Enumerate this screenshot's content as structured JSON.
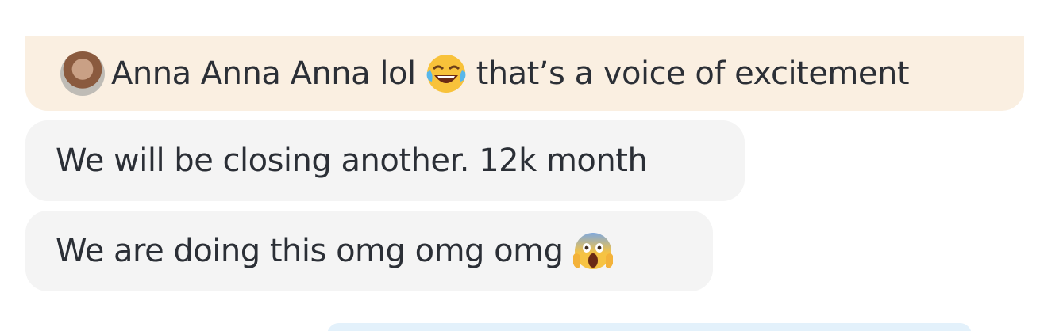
{
  "messages": [
    {
      "avatar_icon": "user-avatar",
      "text_before": "Anna Anna Anna lol",
      "emoji": "laughing-with-tears-emoji",
      "text_after": "that’s a voice of excitement",
      "background": "#faefe1"
    },
    {
      "text": "We will be closing another. 12k month",
      "background": "#f4f4f4"
    },
    {
      "text": "We are doing this omg omg omg",
      "emoji": "screaming-face-emoji",
      "background": "#f4f4f4"
    }
  ],
  "colors": {
    "text": "#2b2f36",
    "outgoing_bubble": "#e3f1fb"
  }
}
